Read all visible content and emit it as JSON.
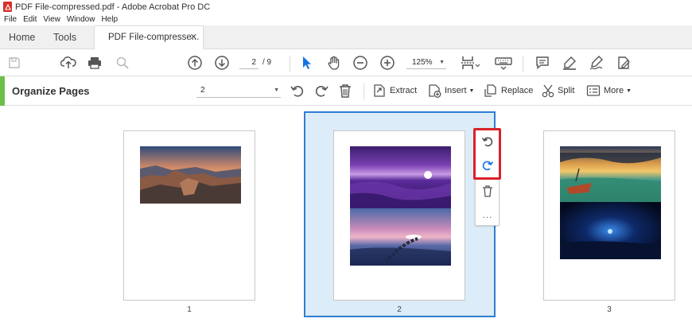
{
  "window": {
    "title": "PDF File-compressed.pdf - Adobe Acrobat Pro DC"
  },
  "menu": [
    "File",
    "Edit",
    "View",
    "Window",
    "Help"
  ],
  "tabs": {
    "home": "Home",
    "tools": "Tools",
    "document": "PDF File-compresse...",
    "close": "✕"
  },
  "toolbar": {
    "current_page": "2",
    "total_pages": "/ 9",
    "zoom": "125%"
  },
  "organize": {
    "title": "Organize Pages",
    "page_select": "2",
    "extract": "Extract",
    "insert": "Insert",
    "replace": "Replace",
    "split": "Split",
    "more": "More"
  },
  "pages": [
    {
      "label": "1",
      "images": [
        "canyon-sunset"
      ]
    },
    {
      "label": "2",
      "images": [
        "purple-sea-sunset",
        "pink-sea-dusk"
      ]
    },
    {
      "label": "3",
      "images": [
        "boat-lake-sunset",
        "blue-night-lake"
      ]
    }
  ],
  "floating_toolbar": {
    "more": "..."
  },
  "colors": {
    "accent_green": "#6cc04a",
    "selection_blue": "#2d7fd0",
    "highlight_red": "#d8232a",
    "pdf_red": "#d6312a"
  }
}
